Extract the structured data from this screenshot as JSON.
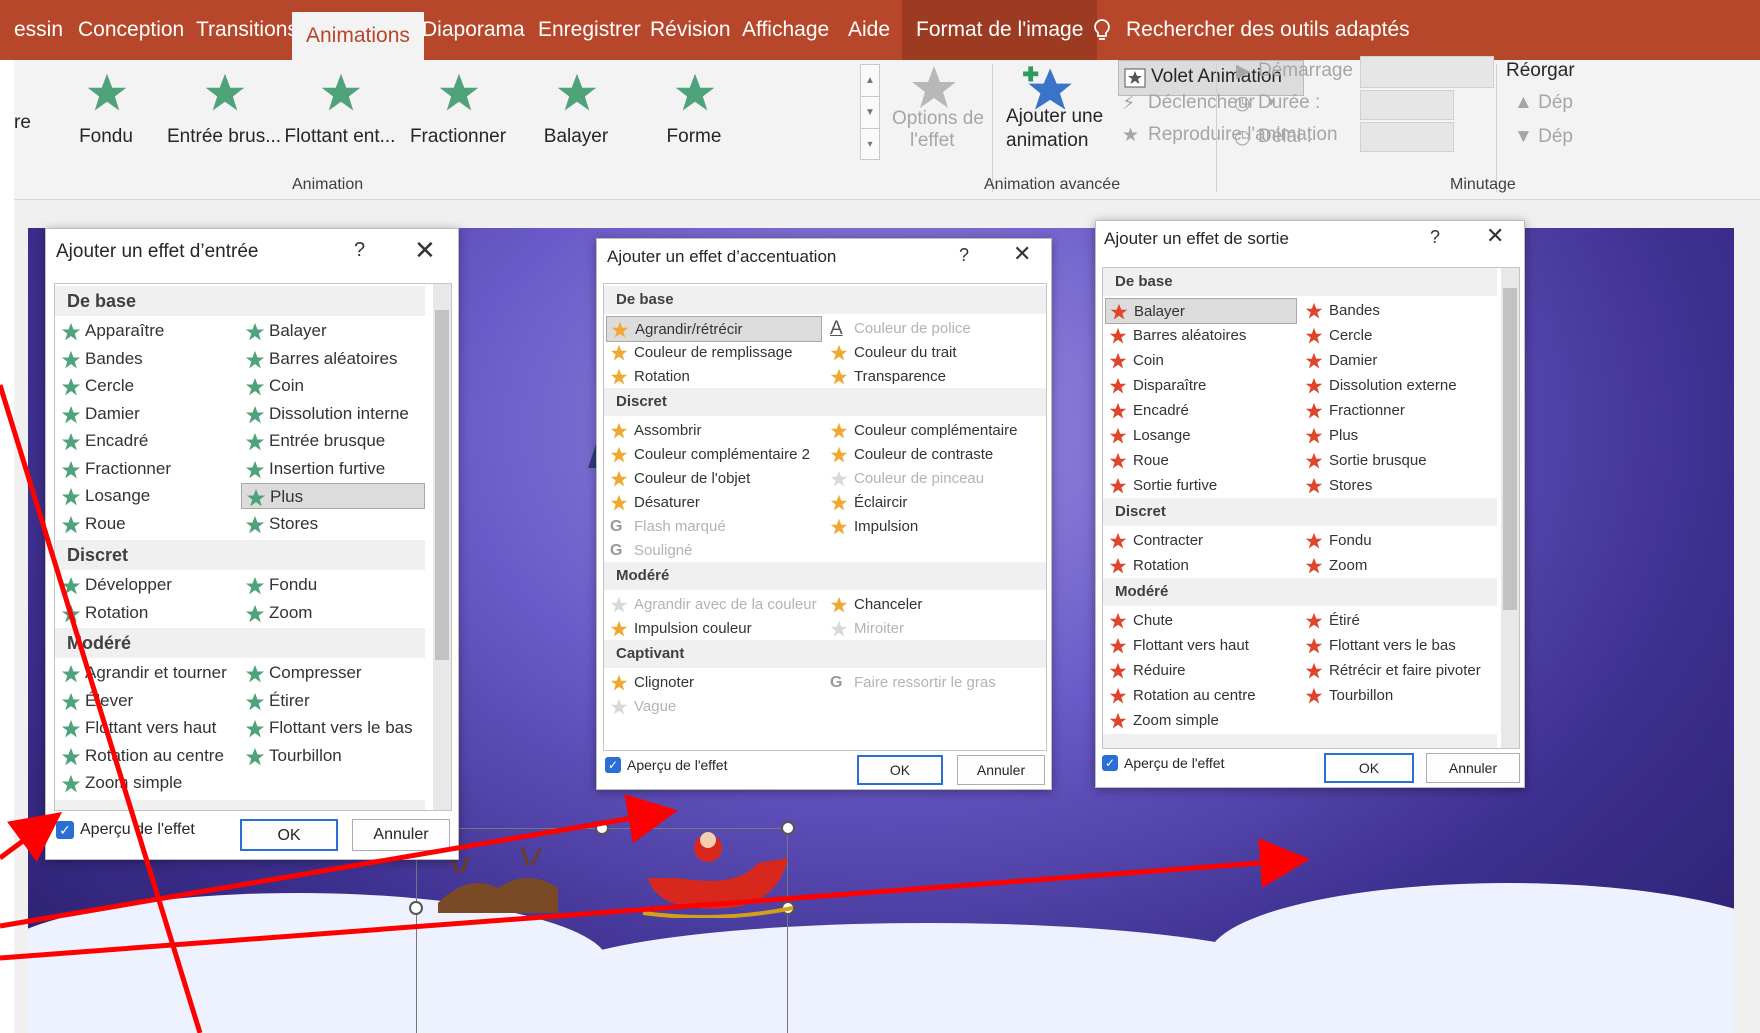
{
  "tabs": {
    "dessin": "essin",
    "conception": "Conception",
    "transitions": "Transitions",
    "animations": "Animations",
    "diaporama": "Diaporama",
    "enregistrer": "Enregistrer",
    "revision": "Révision",
    "affichage": "Affichage",
    "aide": "Aide",
    "format": "Format de l'image",
    "search": "Rechercher des outils adaptés"
  },
  "ribbon": {
    "gallery_partial": "re",
    "gallery": [
      "Fondu",
      "Entrée brus...",
      "Flottant ent...",
      "Fractionner",
      "Balayer",
      "Forme"
    ],
    "options_line1": "Options de",
    "options_line2": "l'effet",
    "group_animation": "Animation",
    "add_line1": "Ajouter une",
    "add_line2": "animation",
    "volet": "Volet Animation",
    "declencheur": "Déclencheur",
    "reproduire": "Reproduire l'animation",
    "group_advanced": "Animation avancée",
    "demarrage": "Démarrage :",
    "duree": "Durée :",
    "delai": "Délai :",
    "reorg": "Réorgar",
    "dep1": "Dép",
    "dep2": "Dép",
    "group_timing": "Minutage"
  },
  "colors": {
    "ribbon_accent": "#b7472a",
    "entrance_star": "#4fa37a",
    "emphasis_star": "#f0a830",
    "exit_star": "#e0452a",
    "arrow": "#ff0000",
    "checkbox": "#2b6fd6"
  },
  "entrance": {
    "title": "Ajouter un effet d’entrée",
    "help": "?",
    "close": "✕",
    "base": "De base",
    "base_col1": [
      "Apparaître",
      "Bandes",
      "Cercle",
      "Damier",
      "Encadré",
      "Fractionner",
      "Losange",
      "Roue"
    ],
    "base_col2": [
      "Balayer",
      "Barres aléatoires",
      "Coin",
      "Dissolution interne",
      "Entrée brusque",
      "Insertion furtive",
      "Plus",
      "Stores"
    ],
    "discret": "Discret",
    "discret_col1": [
      "Développer",
      "Rotation"
    ],
    "discret_col2": [
      "Fondu",
      "Zoom"
    ],
    "modere": "Modéré",
    "modere_col1": [
      "Agrandir et tourner",
      "Élever",
      "Flottant vers haut",
      "Rotation au centre",
      "Zoom simple"
    ],
    "modere_col2": [
      "Compresser",
      "Étirer",
      "Flottant vers le bas",
      "Tourbillon"
    ],
    "preview": "Aperçu de l'effet",
    "ok": "OK",
    "cancel": "Annuler"
  },
  "emphasis": {
    "title": "Ajouter un effet d’accentuation",
    "help": "?",
    "close": "✕",
    "base": "De base",
    "base_col1": [
      "Agrandir/rétrécir",
      "Couleur de remplissage",
      "Rotation"
    ],
    "base_col2": [
      "Couleur de police",
      "Couleur du trait",
      "Transparence"
    ],
    "discret": "Discret",
    "discret_col1": [
      "Assombrir",
      "Couleur complémentaire 2",
      "Couleur de l'objet",
      "Désaturer",
      "Flash marqué",
      "Souligné"
    ],
    "discret_col2": [
      "Couleur complémentaire",
      "Couleur de contraste",
      "Couleur de pinceau",
      "Éclaircir",
      "Impulsion"
    ],
    "modere": "Modéré",
    "modere_col1": [
      "Agrandir avec de la couleur",
      "Impulsion couleur"
    ],
    "modere_col2": [
      "Chanceler",
      "Miroiter"
    ],
    "captivant": "Captivant",
    "captivant_col1": [
      "Clignoter",
      "Vague"
    ],
    "captivant_col2": [
      "Faire ressortir le gras"
    ],
    "preview": "Aperçu de l'effet",
    "ok": "OK",
    "cancel": "Annuler"
  },
  "exit": {
    "title": "Ajouter un effet de sortie",
    "help": "?",
    "close": "✕",
    "base": "De base",
    "base_col1": [
      "Balayer",
      "Barres aléatoires",
      "Coin",
      "Disparaître",
      "Encadré",
      "Losange",
      "Roue",
      "Sortie furtive"
    ],
    "base_col2": [
      "Bandes",
      "Cercle",
      "Damier",
      "Dissolution externe",
      "Fractionner",
      "Plus",
      "Sortie brusque",
      "Stores"
    ],
    "discret": "Discret",
    "discret_col1": [
      "Contracter",
      "Rotation"
    ],
    "discret_col2": [
      "Fondu",
      "Zoom"
    ],
    "modere": "Modéré",
    "modere_col1": [
      "Chute",
      "Flottant vers haut",
      "Réduire",
      "Rotation au centre",
      "Zoom simple"
    ],
    "modere_col2": [
      "Étiré",
      "Flottant vers le bas",
      "Rétrécir et faire pivoter",
      "Tourbillon"
    ],
    "preview": "Aperçu de l'effet",
    "ok": "OK",
    "cancel": "Annuler"
  }
}
